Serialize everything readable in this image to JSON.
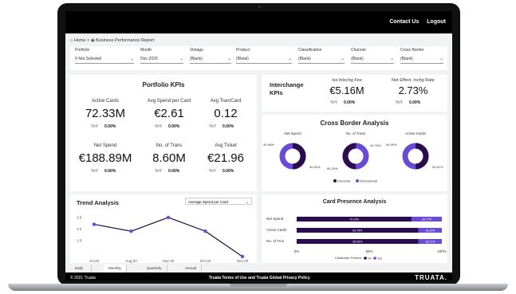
{
  "nav": {
    "contact": "Contact Us",
    "logout": "Logout"
  },
  "breadcrumb": {
    "home": "Home",
    "sep": ">",
    "current": "Business Performance Report"
  },
  "filters": [
    {
      "label": "Portfolio",
      "value": "0-Not Selected"
    },
    {
      "label": "Month",
      "value": "Dec-2020"
    },
    {
      "label": "Vintage",
      "value": "(Blank)"
    },
    {
      "label": "Product",
      "value": "(Blank)"
    },
    {
      "label": "Classification",
      "value": "(Blank)"
    },
    {
      "label": "Channel",
      "value": "(Blank)"
    },
    {
      "label": "Cross Border",
      "value": "(Blank)"
    }
  ],
  "portfolio": {
    "title": "Portfolio KPIs",
    "kpis": [
      {
        "label": "Active Cards",
        "value": "72.33M",
        "yoy_label": "YoY",
        "yoy": "0.00%"
      },
      {
        "label": "Avg Spend per Card",
        "value": "€2.61",
        "yoy_label": "YoY",
        "yoy": "0.00%"
      },
      {
        "label": "Avg Tran/Card",
        "value": "0.12",
        "yoy_label": "YoY",
        "yoy": "0.00%"
      },
      {
        "label": "Net Spend",
        "value": "€188.89M",
        "yoy_label": "YoY",
        "yoy": "0.00%"
      },
      {
        "label": "No. of Trans",
        "value": "8.60M",
        "yoy_label": "YoY",
        "yoy": "0.00%"
      },
      {
        "label": "Avg Ticket",
        "value": "€21.96",
        "yoy_label": "YoY",
        "yoy": "0.00%"
      }
    ]
  },
  "interchange": {
    "title_line1": "Interchange",
    "title_line2": "KPIs",
    "fee_label": "Iss Intechg Fee",
    "fee_value": "€5.16M",
    "fee_yoy_label": "YoY",
    "fee_yoy": "0.00%",
    "rate_label": "Net Effect. Inchg Rate",
    "rate_value": "2.73%",
    "rate_yoy_label": "YoY",
    "rate_yoy": "0.00%"
  },
  "cross_border": {
    "title": "Cross Border Analysis",
    "donuts": [
      {
        "label": "Net Spend",
        "left_pct": "49.48%",
        "right_pct": "50.52%"
      },
      {
        "label": "No. of Trans",
        "left_pct": "50.25%",
        "right_pct": "49.75%"
      },
      {
        "label": "Active Cards",
        "left_pct": "49.39%",
        "right_pct": "50.61%"
      }
    ],
    "legend": [
      "Domestic",
      "International"
    ]
  },
  "chart_data": [
    {
      "type": "line",
      "title": "Trend Analysis",
      "selector": "Average Spend per Card",
      "categories": [
        "Jul-20",
        "Aug-20",
        "Sep-20",
        "Oct-20",
        "Nov-20"
      ],
      "series": [
        {
          "values": [
            3.2,
            2.9,
            3.5,
            2.9,
            1.8
          ]
        }
      ],
      "yticks": [
        "3.5",
        "3.0",
        "2.5"
      ],
      "ylim": [
        1.8,
        3.6
      ]
    },
    {
      "type": "bar",
      "title": "Card Presence Analysis",
      "categories": [
        "Net Spend",
        "Active Cards",
        "No. of Trns"
      ],
      "series": [
        {
          "name": "No",
          "values": [
            79.23,
            83.78,
            83.99
          ],
          "labels": [
            "79.23%",
            "83.78%",
            "83.99%"
          ]
        },
        {
          "name": "Yes",
          "values": [
            20.77,
            16.22,
            16.01
          ],
          "labels": [
            "20.77%",
            "16.22%",
            "16.01%"
          ]
        }
      ],
      "xticks": [
        "0%",
        "50%",
        "100%"
      ],
      "legend_title": "Cardholder Present"
    }
  ],
  "tabs": [
    "Daily Report",
    "Monthly Report",
    "Quarterly Report",
    "Annual Report"
  ],
  "footer": {
    "copyright": "© 2021 Truata",
    "links": "Truata Terms of Use and Truata Global Privacy Policy",
    "brand": "TRUATA."
  },
  "colors": {
    "accent": "#6a4bd6",
    "dark": "#2a0d4d",
    "light": "#e6e6e6"
  }
}
